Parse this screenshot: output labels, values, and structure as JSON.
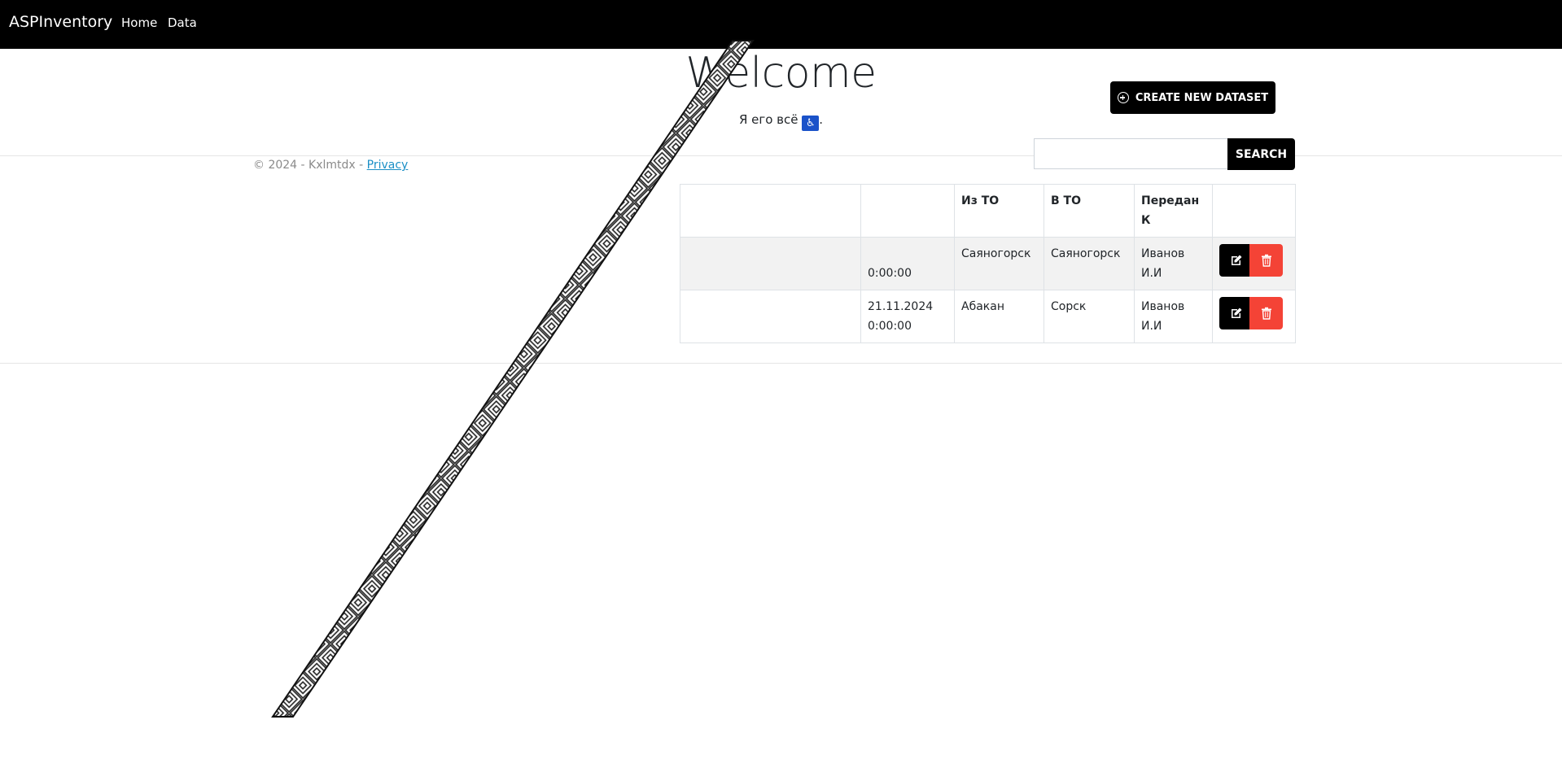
{
  "nav": {
    "brand": "ASPInventory",
    "links": [
      "Home",
      "Data"
    ]
  },
  "hero": {
    "title": "Welcome",
    "subtitle": "Я его всё",
    "icon": "wheelchair-icon",
    "icon_glyph": "♿",
    "punct": "."
  },
  "footer": {
    "text": "© 2024 - Kxlmtdx - ",
    "link": "Privacy"
  },
  "toolbar": {
    "create_label": "CREATE NEW DATASET",
    "search_label": "SEARCH",
    "search_value": ""
  },
  "table": {
    "headers": [
      "",
      "",
      "Из ТО",
      "В ТО",
      "Передан К",
      ""
    ],
    "rows": [
      {
        "c0": "",
        "c1a": "",
        "c1b": "0:00:00",
        "from": "Саяногорск",
        "to": "Саяногорск",
        "handed_a": "Иванов",
        "handed_b": "И.И"
      },
      {
        "c0": "",
        "c1a": "21.11.2024",
        "c1b": "0:00:00",
        "from": "Абакан",
        "to": "Сорск",
        "handed_a": "Иванов",
        "handed_b": "И.И"
      }
    ]
  },
  "colors": {
    "navbar": "#000000",
    "delete": "#f44336",
    "link": "#1b8fc6"
  }
}
